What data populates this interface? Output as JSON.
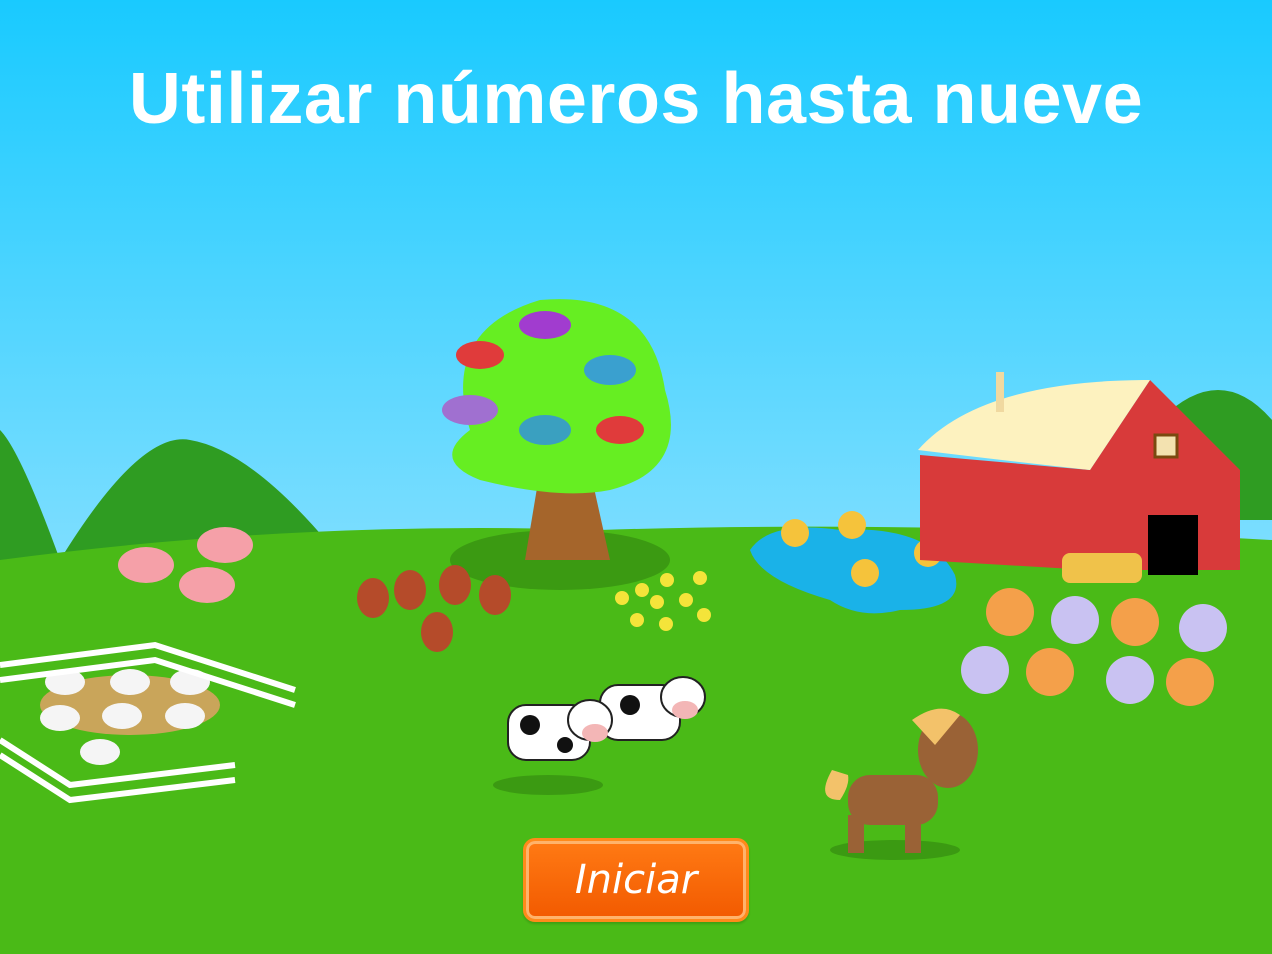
{
  "screen": {
    "title": "Utilizar números hasta nueve",
    "start_button": "Iniciar"
  },
  "scene": {
    "sky_top": "#19caff",
    "sky_bottom": "#c5ecff",
    "grass": "#4aba17",
    "animals": {
      "pigs": 3,
      "sheep": 7,
      "chickens": 5,
      "chicks": 9,
      "cows": 2,
      "ducks": 4,
      "cats": 8,
      "birds": 6,
      "horses": 1
    }
  }
}
